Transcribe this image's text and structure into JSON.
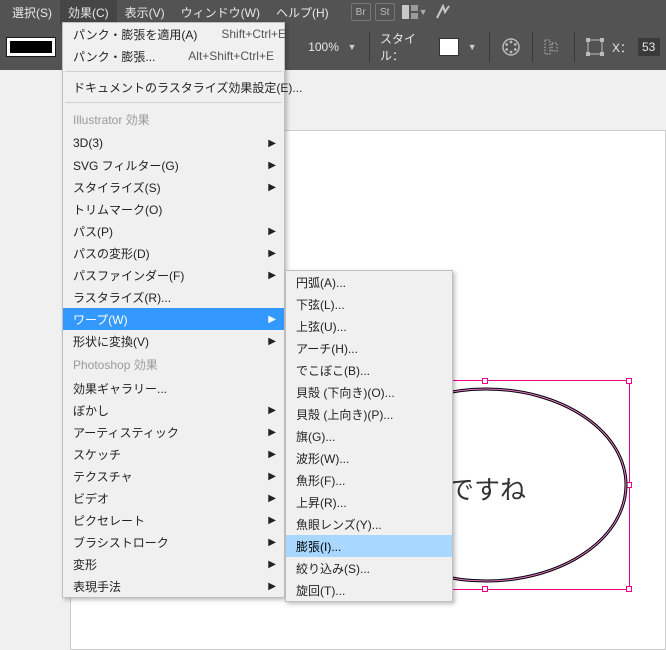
{
  "menubar": {
    "select": "選択(S)",
    "effect": "効果(C)",
    "view": "表示(V)",
    "window": "ウィンドウ(W)",
    "help": "ヘルプ(H)",
    "br": "Br",
    "st": "St"
  },
  "toolbar": {
    "zoom": "100%",
    "style_label": "スタイル：",
    "x_label": "X：",
    "x_value": "53"
  },
  "effect_menu": {
    "apply_last": "パンク・膨張を適用(A)",
    "apply_last_sc": "Shift+Ctrl+E",
    "last": "パンク・膨張...",
    "last_sc": "Alt+Shift+Ctrl+E",
    "doc_raster": "ドキュメントのラスタライズ効果設定(E)...",
    "sec_illustrator": "Illustrator 効果",
    "i3d": "3D(3)",
    "svg": "SVG フィルター(G)",
    "stylize": "スタイライズ(S)",
    "trim": "トリムマーク(O)",
    "path": "パス(P)",
    "distort": "パスの変形(D)",
    "pathfinder": "パスファインダー(F)",
    "rasterize": "ラスタライズ(R)...",
    "warp": "ワープ(W)",
    "convert": "形状に変換(V)",
    "sec_photoshop": "Photoshop 効果",
    "gallery": "効果ギャラリー...",
    "blur": "ぼかし",
    "artistic": "アーティスティック",
    "sketch": "スケッチ",
    "texture": "テクスチャ",
    "video": "ビデオ",
    "pixelate": "ピクセレート",
    "brush": "ブラシストローク",
    "deform": "変形",
    "express": "表現手法"
  },
  "warp_submenu": {
    "arc": "円弧(A)...",
    "arc_lower": "下弦(L)...",
    "arc_upper": "上弦(U)...",
    "arch": "アーチ(H)...",
    "bulge": "でこぼこ(B)...",
    "shell_lower": "貝殻 (下向き)(O)...",
    "shell_upper": "貝殻 (上向き)(P)...",
    "flag": "旗(G)...",
    "wave": "波形(W)...",
    "fish": "魚形(F)...",
    "rise": "上昇(R)...",
    "fisheye": "魚眼レンズ(Y)...",
    "inflate": "膨張(I)...",
    "squeeze": "絞り込み(S)...",
    "twist": "旋回(T)..."
  },
  "canvas": {
    "text_fragment": "ですね"
  }
}
